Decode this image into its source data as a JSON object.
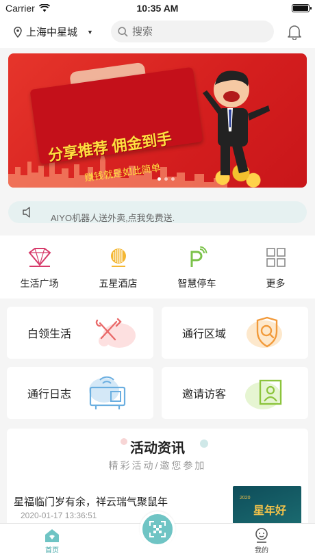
{
  "status_bar": {
    "carrier": "Carrier",
    "time": "10:35 AM"
  },
  "header": {
    "location": "上海中星城",
    "search_placeholder": "搜索"
  },
  "banner": {
    "headline": "分享推荐 佣金到手",
    "subline": "赚钱就是如此简单",
    "page_count": 3,
    "active_index": 0
  },
  "notice": {
    "text": "AIYO机器人送外卖,点我免费送."
  },
  "quick_entries": [
    {
      "label": "生活广场",
      "icon": "life-plaza-logo"
    },
    {
      "label": "五星酒店",
      "icon": "hotel-logo"
    },
    {
      "label": "智慧停车",
      "icon": "parking-icon"
    },
    {
      "label": "更多",
      "icon": "grid-more-icon"
    }
  ],
  "service_cards": [
    {
      "label": "白领生活",
      "icon": "tools-icon"
    },
    {
      "label": "通行区域",
      "icon": "shield-search-icon"
    },
    {
      "label": "通行日志",
      "icon": "access-device-icon"
    },
    {
      "label": "邀请访客",
      "icon": "visitor-card-icon"
    }
  ],
  "news": {
    "title": "活动资讯",
    "subtitle": "精彩活动/邀您参加",
    "items": [
      {
        "title": "星福临门岁有余，祥云瑞气聚鼠年",
        "date": "2020-01-17 13:36:51",
        "thumb_year": "2020",
        "thumb_text": "星年好"
      }
    ]
  },
  "tabbar": {
    "home": "首页",
    "mine": "我的"
  },
  "colors": {
    "accent": "#3aa3a3",
    "banner_red": "#d41e1e",
    "notice_bg": "#e6f1f1"
  }
}
